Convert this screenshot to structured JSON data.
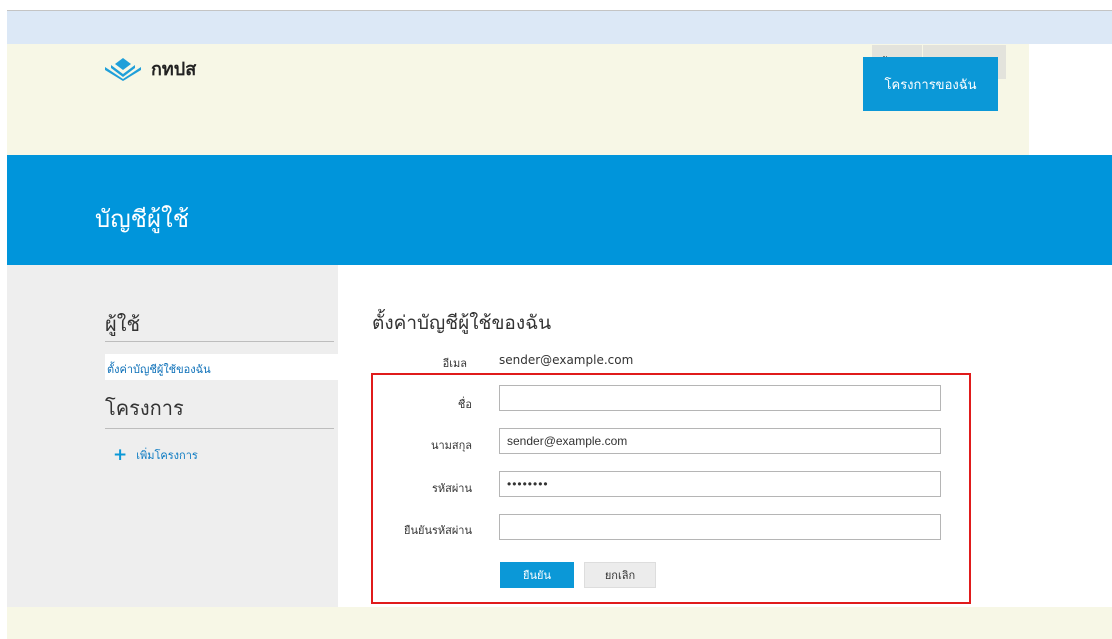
{
  "header": {
    "logo_text": "กทปส",
    "utility_nav": [
      "จัดการ",
      "ออกจากระบบ"
    ],
    "project_tab": "โครงการของฉัน"
  },
  "banner": {
    "title": "บัญชีผู้ใช้"
  },
  "sidebar": {
    "user_heading": "ผู้ใช้",
    "account_settings_link": "ตั้งค่าบัญชีผู้ใช้ของฉัน",
    "project_heading": "โครงการ",
    "add_project_label": "เพิ่มโครงการ"
  },
  "main": {
    "title": "ตั้งค่าบัญชีผู้ใช้ของฉัน",
    "email_label": "อีเมล",
    "email_value": "sender@example.com"
  },
  "form": {
    "first_name_label": "ชื่อ",
    "first_name_value": "",
    "last_name_label": "นามสกุล",
    "last_name_value": "sender@example.com",
    "password_label": "รหัสผ่าน",
    "password_value": "••••••••",
    "confirm_password_label": "ยืนยันรหัสผ่าน",
    "confirm_password_value": "",
    "confirm_button": "ยืนยัน",
    "cancel_button": "ยกเลิก"
  },
  "colors": {
    "accent": "#0095db",
    "header_bg": "#f7f7e6",
    "highlight_border": "#e01b1b"
  }
}
